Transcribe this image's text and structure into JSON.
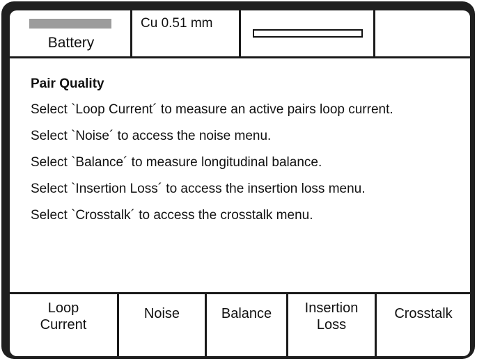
{
  "status_bar": {
    "battery_label": "Battery",
    "gauge_label": "Cu 0.51 mm"
  },
  "content": {
    "title": "Pair Quality",
    "lines": [
      "Select `Loop Current´ to measure an active pairs loop current.",
      "Select `Noise´ to access the noise menu.",
      "Select `Balance´ to measure longitudinal balance.",
      "Select `Insertion Loss´ to access the insertion loss menu.",
      "Select `Crosstalk´ to access the crosstalk menu."
    ]
  },
  "softkeys": [
    {
      "label": "Loop\nCurrent"
    },
    {
      "label": "Noise"
    },
    {
      "label": "Balance"
    },
    {
      "label": "Insertion\nLoss"
    },
    {
      "label": "Crosstalk"
    }
  ],
  "colors": {
    "bezel": "#1f1f1f",
    "screen": "#ffffff",
    "battery_fill": "#9c9c9c"
  }
}
